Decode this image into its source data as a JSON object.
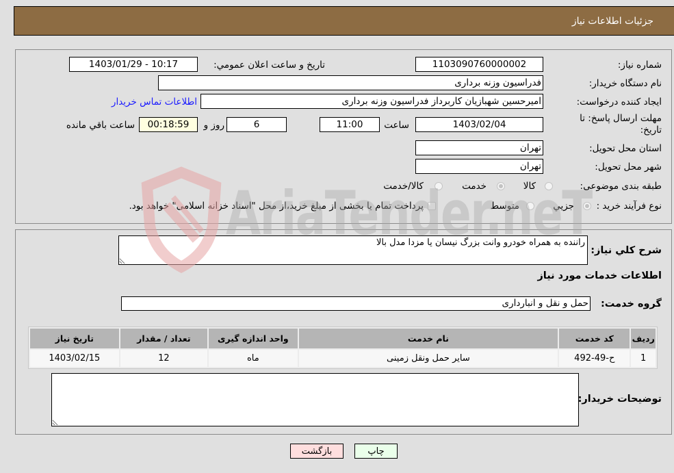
{
  "header": {
    "title": "جزئیات اطلاعات نیاز"
  },
  "form": {
    "need_number_label": "شماره نیاز:",
    "need_number": "1103090760000002",
    "announce_label": "تاریخ و ساعت اعلان عمومي:",
    "announce_value": "1403/01/29 - 10:17",
    "buyer_org_label": "نام دستگاه خریدار:",
    "buyer_org": "فدراسیون وزنه برداری",
    "creator_label": "ایجاد کننده درخواست:",
    "creator": "امیرحسین شهبازیان کاربرداز فدراسیون وزنه برداری",
    "contact_link": "اطلاعات تماس خریدار",
    "deadline_label": "مهلت ارسال پاسخ: تا تاریخ:",
    "deadline_date": "1403/02/04",
    "time_label": "ساعت",
    "deadline_time": "11:00",
    "days_value": "6",
    "days_label": "روز و",
    "remaining_time": "00:18:59",
    "remaining_label": "ساعت باقي مانده",
    "province_label": "استان محل تحویل:",
    "province": "تهران",
    "city_label": "شهر محل تحویل:",
    "city": "تهران",
    "category_label": "طبقه بندی موضوعی:",
    "category_options": [
      {
        "label": "کالا",
        "selected": false
      },
      {
        "label": "خدمت",
        "selected": true
      },
      {
        "label": "کالا/خدمت",
        "selected": false
      }
    ],
    "purchase_type_label": "نوع فرآیند خرید :",
    "purchase_type_options": [
      {
        "label": "جزيي",
        "selected": true
      },
      {
        "label": "متوسط",
        "selected": false
      }
    ],
    "treasury_checkbox_label": "پرداخت تمام یا بخشی از مبلغ خرید،از محل \"اسناد خزانه اسلامی\" خواهد بود.",
    "treasury_checked": false
  },
  "details": {
    "description_label": "شرح کلي نیاز:",
    "description": "راننده به همراه خودرو وانت بزرگ نیسان یا مزدا مدل بالا",
    "services_heading": "اطلاعات خدمات مورد نیاز",
    "service_group_label": "گروه خدمت:",
    "service_group": "حمل و نقل و انبارداری",
    "table": {
      "headers": [
        "ردیف",
        "کد خدمت",
        "نام خدمت",
        "واحد اندازه گیری",
        "تعداد / مقدار",
        "تاریخ نیاز"
      ],
      "rows": [
        [
          "1",
          "ح-49-492",
          "سایر حمل ونقل زمینی",
          "ماه",
          "12",
          "1403/02/15"
        ]
      ]
    },
    "buyer_notes_label": "توضیحات خریدار:",
    "buyer_notes": ""
  },
  "buttons": {
    "print": "چاپ",
    "back": "بازگشت"
  },
  "colors": {
    "header_bg": "#8d6c43",
    "print_bg": "#eaffea",
    "back_bg": "#ffdede",
    "link": "#1a1aff"
  },
  "watermark": {
    "text": "AriaTender.neT"
  }
}
